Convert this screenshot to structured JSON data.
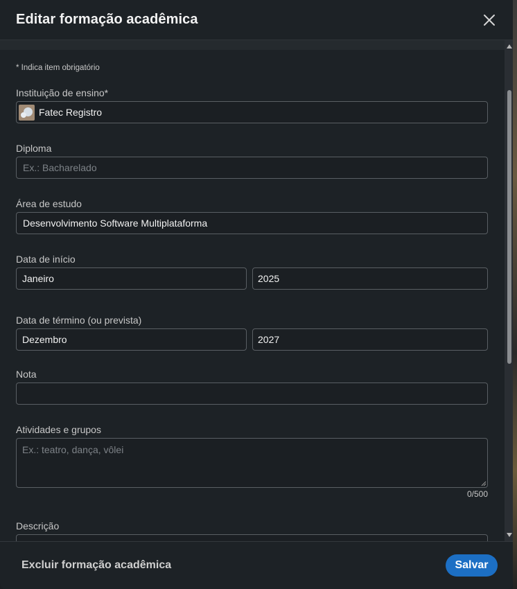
{
  "header": {
    "title": "Editar formação acadêmica",
    "close_icon": "close-icon"
  },
  "form": {
    "required_note": "* Indica item obrigatório",
    "institution": {
      "label": "Instituição de ensino*",
      "value": "Fatec Registro"
    },
    "degree": {
      "label": "Diploma",
      "placeholder": "Ex.: Bacharelado"
    },
    "field_of_study": {
      "label": "Área de estudo",
      "value": "Desenvolvimento Software Multiplataforma"
    },
    "start_date": {
      "label": "Data de início",
      "month": "Janeiro",
      "year": "2025"
    },
    "end_date": {
      "label": "Data de término (ou prevista)",
      "month": "Dezembro",
      "year": "2027"
    },
    "grade": {
      "label": "Nota",
      "value": ""
    },
    "activities": {
      "label": "Atividades e grupos",
      "placeholder": "Ex.: teatro, dança, vôlei",
      "counter": "0/500"
    },
    "description": {
      "label": "Descrição"
    }
  },
  "footer": {
    "delete_label": "Excluir formação acadêmica",
    "save_label": "Salvar"
  },
  "colors": {
    "primary": "#1c6fc4",
    "background": "#1d2226"
  }
}
